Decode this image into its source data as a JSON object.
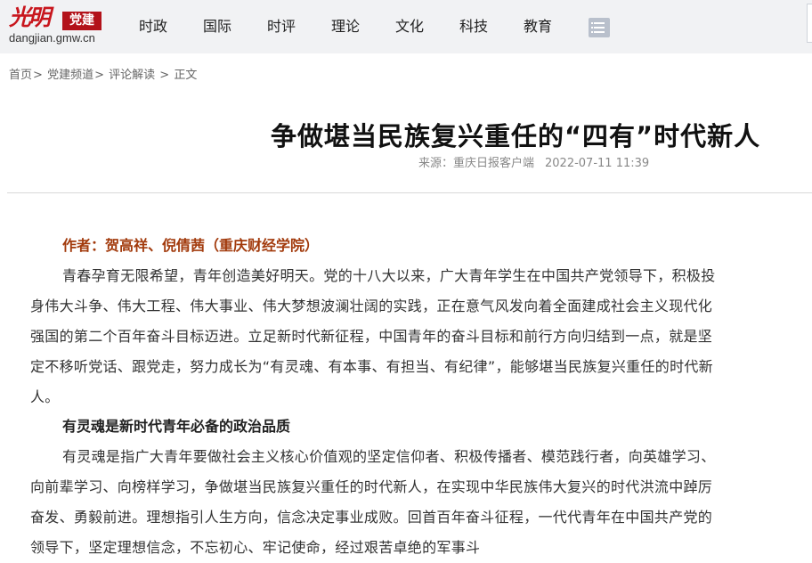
{
  "header": {
    "logo_mark": "光明",
    "logo_badge": "党建",
    "logo_domain": "dangjian.gmw.cn",
    "nav": [
      "时政",
      "国际",
      "时评",
      "理论",
      "文化",
      "科技",
      "教育"
    ]
  },
  "breadcrumb": {
    "items": [
      "首页",
      "党建频道",
      "评论解读",
      "正文"
    ],
    "sep": ">"
  },
  "article": {
    "title": "争做堪当民族复兴重任的“四有”时代新人",
    "source": "来源：重庆日报客户端",
    "datetime": "2022-07-11 11:39",
    "author": "作者：贺高祥、倪倩茜（重庆财经学院）",
    "para1": "青春孕育无限希望，青年创造美好明天。党的十八大以来，广大青年学生在中国共产党领导下，积极投身伟大斗争、伟大工程、伟大事业、伟大梦想波澜壮阔的实践，正在意气风发向着全面建成社会主义现代化强国的第二个百年奋斗目标迈进。立足新时代新征程，中国青年的奋斗目标和前行方向归结到一点，就是坚定不移听党话、跟党走，努力成长为“有灵魂、有本事、有担当、有纪律”，能够堪当民族复兴重任的时代新人。",
    "subhead1": "有灵魂是新时代青年必备的政治品质",
    "para2": "有灵魂是指广大青年要做社会主义核心价值观的坚定信仰者、积极传播者、模范践行者，向英雄学习、向前辈学习、向榜样学习，争做堪当民族复兴重任的时代新人，在实现中华民族伟大复兴的时代洪流中踔厉奋发、勇毅前进。理想指引人生方向，信念决定事业成败。回首百年奋斗征程，一代代青年在中国共产党的领导下，坚定理想信念，不忘初心、牢记使命，经过艰苦卓绝的军事斗"
  },
  "colors": {
    "brand_red": "#c8161d",
    "author_color": "#a23a0c",
    "topbar_bg": "#f1f2f4"
  },
  "icons": {
    "menu": "list-menu-icon"
  }
}
